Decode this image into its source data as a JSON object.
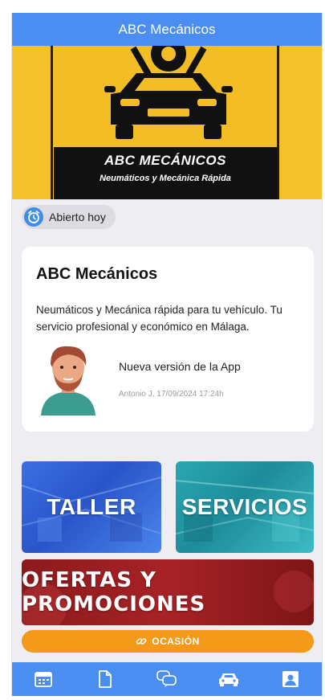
{
  "header": {
    "title": "ABC Mecánicos"
  },
  "banner": {
    "brand": "ABC MECÁNICOS",
    "tagline": "Neumáticos y Mecánica Rápida"
  },
  "status": {
    "label": "Abierto hoy",
    "icon": "alarm-clock-icon"
  },
  "card": {
    "title": "ABC Mecánicos",
    "description": "Neumáticos y Mecánica rápida para tu vehículo. Tu servicio profesional y económico en Málaga.",
    "news_title": "Nueva versión de la App",
    "news_meta": "Antonio J, 17/09/2024 17:24h"
  },
  "tiles": {
    "taller": "TALLER",
    "servicios": "SERVICIOS",
    "ofertas": "OFERTAS Y PROMOCIONES"
  },
  "ocasion": {
    "label": "OCASIÓN",
    "icon": "link-icon"
  },
  "tabbar": {
    "icons": [
      "calendar-icon",
      "document-icon",
      "chat-icon",
      "car-icon",
      "contact-card-icon"
    ]
  },
  "colors": {
    "primary": "#4b8ef1",
    "banner_yellow": "#f4c12c",
    "accent_orange": "#f39a1a",
    "background": "#eeeef2"
  }
}
